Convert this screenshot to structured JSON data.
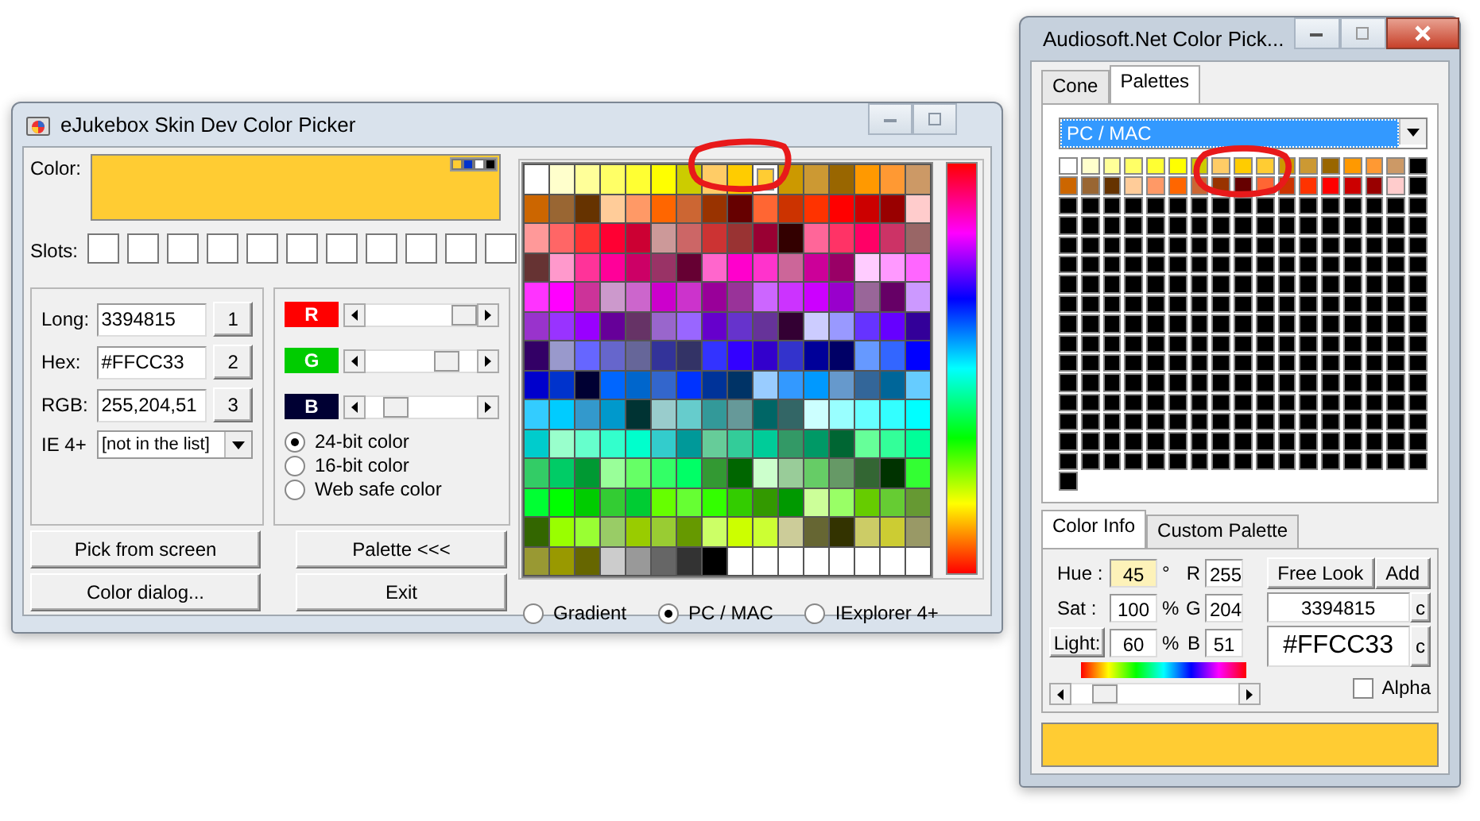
{
  "left_window": {
    "title": "eJukebox Skin Dev Color Picker",
    "color_label": "Color:",
    "color": "#ffcc33",
    "corner_marks": [
      {
        "color": "#ffcc33"
      },
      {
        "color": "#0033cc"
      },
      {
        "color": "#ffffff"
      },
      {
        "color": "#000000"
      }
    ],
    "slots_label": "Slots:",
    "slots": [
      {
        "color": "#ffffff"
      },
      {
        "color": "#ffffff"
      },
      {
        "color": "#ffffff"
      },
      {
        "color": "#ffffff"
      },
      {
        "color": "#ffffff"
      },
      {
        "color": "#ffffff"
      },
      {
        "color": "#ffffff"
      },
      {
        "color": "#ffffff"
      },
      {
        "color": "#ffffff"
      },
      {
        "color": "#ffffff"
      },
      {
        "color": "#ffffff"
      }
    ],
    "fields": [
      {
        "label": "Long:",
        "value": "3394815",
        "button": "1"
      },
      {
        "label": "Hex:",
        "value": "#FFCC33",
        "button": "2"
      },
      {
        "label": "RGB:",
        "value": "255,204,51",
        "button": "3"
      }
    ],
    "ie": {
      "label": "IE 4+",
      "value": "[not in the list]"
    },
    "channels": [
      {
        "label": "R",
        "color": "#ff0000",
        "level": 1
      },
      {
        "label": "G",
        "color": "#00cc00",
        "level": 0.8
      },
      {
        "label": "B",
        "color": "#000033",
        "level": 0.2
      }
    ],
    "depth_options": [
      {
        "label": "24-bit color",
        "selected": true
      },
      {
        "label": "16-bit color",
        "selected": false
      },
      {
        "label": "Web safe color",
        "selected": false
      }
    ],
    "buttons": [
      "Pick from screen",
      "Palette <<<",
      "Color dialog...",
      "Exit"
    ],
    "palette": [
      [
        {
          "color": "#ffffff",
          "selected": false
        },
        {
          "color": "#ffffcc",
          "selected": false
        },
        {
          "color": "#ffff99",
          "selected": false
        },
        {
          "color": "#ffff66",
          "selected": false
        },
        {
          "color": "#ffff33",
          "selected": false
        },
        {
          "color": "#ffff00",
          "selected": false
        },
        {
          "color": "#cccc00",
          "selected": false
        },
        {
          "color": "#ffcc66",
          "selected": false
        },
        {
          "color": "#ffcc00",
          "selected": false
        },
        {
          "color": "#ffcc33",
          "selected": true
        },
        {
          "color": "#cc9900",
          "selected": false
        },
        {
          "color": "#cc9933",
          "selected": false
        },
        {
          "color": "#996600",
          "selected": false
        },
        {
          "color": "#ff9900",
          "selected": false
        },
        {
          "color": "#ff9933",
          "selected": false
        },
        {
          "color": "#cc9966",
          "selected": false
        }
      ],
      [
        {
          "color": "#cc6600",
          "selected": false
        },
        {
          "color": "#996633",
          "selected": false
        },
        {
          "color": "#663300",
          "selected": false
        },
        {
          "color": "#ffcc99",
          "selected": false
        },
        {
          "color": "#ff9966",
          "selected": false
        },
        {
          "color": "#ff6600",
          "selected": false
        },
        {
          "color": "#cc6633",
          "selected": false
        },
        {
          "color": "#993300",
          "selected": false
        },
        {
          "color": "#660000",
          "selected": false
        },
        {
          "color": "#ff6633",
          "selected": false
        },
        {
          "color": "#cc3300",
          "selected": false
        },
        {
          "color": "#ff3300",
          "selected": false
        },
        {
          "color": "#ff0000",
          "selected": false
        },
        {
          "color": "#cc0000",
          "selected": false
        },
        {
          "color": "#990000",
          "selected": false
        },
        {
          "color": "#ffcccc",
          "selected": false
        }
      ],
      [
        {
          "color": "#ff9999",
          "selected": false
        },
        {
          "color": "#ff6666",
          "selected": false
        },
        {
          "color": "#ff3333",
          "selected": false
        },
        {
          "color": "#ff0033",
          "selected": false
        },
        {
          "color": "#cc0033",
          "selected": false
        },
        {
          "color": "#cc9999",
          "selected": false
        },
        {
          "color": "#cc6666",
          "selected": false
        },
        {
          "color": "#cc3333",
          "selected": false
        },
        {
          "color": "#993333",
          "selected": false
        },
        {
          "color": "#990033",
          "selected": false
        },
        {
          "color": "#330000",
          "selected": false
        },
        {
          "color": "#ff6699",
          "selected": false
        },
        {
          "color": "#ff3366",
          "selected": false
        },
        {
          "color": "#ff0066",
          "selected": false
        },
        {
          "color": "#cc3366",
          "selected": false
        },
        {
          "color": "#996666",
          "selected": false
        }
      ],
      [
        {
          "color": "#663333",
          "selected": false
        },
        {
          "color": "#ff99cc",
          "selected": false
        },
        {
          "color": "#ff3399",
          "selected": false
        },
        {
          "color": "#ff0099",
          "selected": false
        },
        {
          "color": "#cc0066",
          "selected": false
        },
        {
          "color": "#993366",
          "selected": false
        },
        {
          "color": "#660033",
          "selected": false
        },
        {
          "color": "#ff66cc",
          "selected": false
        },
        {
          "color": "#ff00cc",
          "selected": false
        },
        {
          "color": "#ff33cc",
          "selected": false
        },
        {
          "color": "#cc6699",
          "selected": false
        },
        {
          "color": "#cc0099",
          "selected": false
        },
        {
          "color": "#990066",
          "selected": false
        },
        {
          "color": "#ffccff",
          "selected": false
        },
        {
          "color": "#ff99ff",
          "selected": false
        },
        {
          "color": "#ff66ff",
          "selected": false
        }
      ],
      [
        {
          "color": "#ff33ff",
          "selected": false
        },
        {
          "color": "#ff00ff",
          "selected": false
        },
        {
          "color": "#cc3399",
          "selected": false
        },
        {
          "color": "#cc99cc",
          "selected": false
        },
        {
          "color": "#cc66cc",
          "selected": false
        },
        {
          "color": "#cc00cc",
          "selected": false
        },
        {
          "color": "#cc33cc",
          "selected": false
        },
        {
          "color": "#990099",
          "selected": false
        },
        {
          "color": "#993399",
          "selected": false
        },
        {
          "color": "#cc66ff",
          "selected": false
        },
        {
          "color": "#cc33ff",
          "selected": false
        },
        {
          "color": "#cc00ff",
          "selected": false
        },
        {
          "color": "#9900cc",
          "selected": false
        },
        {
          "color": "#996699",
          "selected": false
        },
        {
          "color": "#660066",
          "selected": false
        },
        {
          "color": "#cc99ff",
          "selected": false
        }
      ],
      [
        {
          "color": "#9933cc",
          "selected": false
        },
        {
          "color": "#9933ff",
          "selected": false
        },
        {
          "color": "#9900ff",
          "selected": false
        },
        {
          "color": "#660099",
          "selected": false
        },
        {
          "color": "#663366",
          "selected": false
        },
        {
          "color": "#9966cc",
          "selected": false
        },
        {
          "color": "#9966ff",
          "selected": false
        },
        {
          "color": "#6600cc",
          "selected": false
        },
        {
          "color": "#6633cc",
          "selected": false
        },
        {
          "color": "#663399",
          "selected": false
        },
        {
          "color": "#330033",
          "selected": false
        },
        {
          "color": "#ccccff",
          "selected": false
        },
        {
          "color": "#9999ff",
          "selected": false
        },
        {
          "color": "#6633ff",
          "selected": false
        },
        {
          "color": "#6600ff",
          "selected": false
        },
        {
          "color": "#330099",
          "selected": false
        }
      ],
      [
        {
          "color": "#330066",
          "selected": false
        },
        {
          "color": "#9999cc",
          "selected": false
        },
        {
          "color": "#6666ff",
          "selected": false
        },
        {
          "color": "#6666cc",
          "selected": false
        },
        {
          "color": "#666699",
          "selected": false
        },
        {
          "color": "#333399",
          "selected": false
        },
        {
          "color": "#333366",
          "selected": false
        },
        {
          "color": "#3333ff",
          "selected": false
        },
        {
          "color": "#3300ff",
          "selected": false
        },
        {
          "color": "#3300cc",
          "selected": false
        },
        {
          "color": "#3333cc",
          "selected": false
        },
        {
          "color": "#000099",
          "selected": false
        },
        {
          "color": "#000066",
          "selected": false
        },
        {
          "color": "#6699ff",
          "selected": false
        },
        {
          "color": "#3366ff",
          "selected": false
        },
        {
          "color": "#0000ff",
          "selected": false
        }
      ],
      [
        {
          "color": "#0000cc",
          "selected": false
        },
        {
          "color": "#0033cc",
          "selected": false
        },
        {
          "color": "#000033",
          "selected": false
        },
        {
          "color": "#0066ff",
          "selected": false
        },
        {
          "color": "#0066cc",
          "selected": false
        },
        {
          "color": "#3366cc",
          "selected": false
        },
        {
          "color": "#0033ff",
          "selected": false
        },
        {
          "color": "#003399",
          "selected": false
        },
        {
          "color": "#003366",
          "selected": false
        },
        {
          "color": "#99ccff",
          "selected": false
        },
        {
          "color": "#3399ff",
          "selected": false
        },
        {
          "color": "#0099ff",
          "selected": false
        },
        {
          "color": "#6699cc",
          "selected": false
        },
        {
          "color": "#336699",
          "selected": false
        },
        {
          "color": "#006699",
          "selected": false
        },
        {
          "color": "#66ccff",
          "selected": false
        }
      ],
      [
        {
          "color": "#33ccff",
          "selected": false
        },
        {
          "color": "#00ccff",
          "selected": false
        },
        {
          "color": "#3399cc",
          "selected": false
        },
        {
          "color": "#0099cc",
          "selected": false
        },
        {
          "color": "#003333",
          "selected": false
        },
        {
          "color": "#99cccc",
          "selected": false
        },
        {
          "color": "#66cccc",
          "selected": false
        },
        {
          "color": "#339999",
          "selected": false
        },
        {
          "color": "#669999",
          "selected": false
        },
        {
          "color": "#006666",
          "selected": false
        },
        {
          "color": "#336666",
          "selected": false
        },
        {
          "color": "#ccffff",
          "selected": false
        },
        {
          "color": "#99ffff",
          "selected": false
        },
        {
          "color": "#66ffff",
          "selected": false
        },
        {
          "color": "#33ffff",
          "selected": false
        },
        {
          "color": "#00ffff",
          "selected": false
        }
      ],
      [
        {
          "color": "#00cccc",
          "selected": false
        },
        {
          "color": "#99ffcc",
          "selected": false
        },
        {
          "color": "#66ffcc",
          "selected": false
        },
        {
          "color": "#33ffcc",
          "selected": false
        },
        {
          "color": "#00ffcc",
          "selected": false
        },
        {
          "color": "#33cccc",
          "selected": false
        },
        {
          "color": "#009999",
          "selected": false
        },
        {
          "color": "#66cc99",
          "selected": false
        },
        {
          "color": "#33cc99",
          "selected": false
        },
        {
          "color": "#00cc99",
          "selected": false
        },
        {
          "color": "#339966",
          "selected": false
        },
        {
          "color": "#009966",
          "selected": false
        },
        {
          "color": "#006633",
          "selected": false
        },
        {
          "color": "#66ff99",
          "selected": false
        },
        {
          "color": "#33ff99",
          "selected": false
        },
        {
          "color": "#00ff99",
          "selected": false
        }
      ],
      [
        {
          "color": "#33cc66",
          "selected": false
        },
        {
          "color": "#00cc66",
          "selected": false
        },
        {
          "color": "#009933",
          "selected": false
        },
        {
          "color": "#99ff99",
          "selected": false
        },
        {
          "color": "#66ff66",
          "selected": false
        },
        {
          "color": "#33ff66",
          "selected": false
        },
        {
          "color": "#00ff66",
          "selected": false
        },
        {
          "color": "#339933",
          "selected": false
        },
        {
          "color": "#006600",
          "selected": false
        },
        {
          "color": "#ccffcc",
          "selected": false
        },
        {
          "color": "#99cc99",
          "selected": false
        },
        {
          "color": "#66cc66",
          "selected": false
        },
        {
          "color": "#669966",
          "selected": false
        },
        {
          "color": "#336633",
          "selected": false
        },
        {
          "color": "#003300",
          "selected": false
        },
        {
          "color": "#33ff33",
          "selected": false
        }
      ],
      [
        {
          "color": "#00ff33",
          "selected": false
        },
        {
          "color": "#00ff00",
          "selected": false
        },
        {
          "color": "#00cc00",
          "selected": false
        },
        {
          "color": "#33cc33",
          "selected": false
        },
        {
          "color": "#00cc33",
          "selected": false
        },
        {
          "color": "#66ff00",
          "selected": false
        },
        {
          "color": "#66ff33",
          "selected": false
        },
        {
          "color": "#33ff00",
          "selected": false
        },
        {
          "color": "#33cc00",
          "selected": false
        },
        {
          "color": "#339900",
          "selected": false
        },
        {
          "color": "#009900",
          "selected": false
        },
        {
          "color": "#ccff99",
          "selected": false
        },
        {
          "color": "#99ff66",
          "selected": false
        },
        {
          "color": "#66cc00",
          "selected": false
        },
        {
          "color": "#66cc33",
          "selected": false
        },
        {
          "color": "#669933",
          "selected": false
        }
      ],
      [
        {
          "color": "#336600",
          "selected": false
        },
        {
          "color": "#99ff00",
          "selected": false
        },
        {
          "color": "#99ff33",
          "selected": false
        },
        {
          "color": "#99cc66",
          "selected": false
        },
        {
          "color": "#99cc00",
          "selected": false
        },
        {
          "color": "#99cc33",
          "selected": false
        },
        {
          "color": "#669900",
          "selected": false
        },
        {
          "color": "#ccff66",
          "selected": false
        },
        {
          "color": "#ccff00",
          "selected": false
        },
        {
          "color": "#ccff33",
          "selected": false
        },
        {
          "color": "#cccc99",
          "selected": false
        },
        {
          "color": "#666633",
          "selected": false
        },
        {
          "color": "#333300",
          "selected": false
        },
        {
          "color": "#cccc66",
          "selected": false
        },
        {
          "color": "#cccc33",
          "selected": false
        },
        {
          "color": "#999966",
          "selected": false
        }
      ],
      [
        {
          "color": "#999933",
          "selected": false
        },
        {
          "color": "#999900",
          "selected": false
        },
        {
          "color": "#666600",
          "selected": false
        },
        {
          "color": "#cccccc",
          "selected": false
        },
        {
          "color": "#999999",
          "selected": false
        },
        {
          "color": "#666666",
          "selected": false
        },
        {
          "color": "#333333",
          "selected": false
        },
        {
          "color": "#000000",
          "selected": false
        },
        {
          "color": "#ffffff",
          "selected": false
        },
        {
          "color": "#ffffff",
          "selected": false
        },
        {
          "color": "#ffffff",
          "selected": false
        },
        {
          "color": "#ffffff",
          "selected": false
        },
        {
          "color": "#ffffff",
          "selected": false
        },
        {
          "color": "#ffffff",
          "selected": false
        },
        {
          "color": "#ffffff",
          "selected": false
        },
        {
          "color": "#ffffff",
          "selected": false
        }
      ]
    ],
    "palette_options": [
      {
        "label": "Gradient",
        "selected": false
      },
      {
        "label": "PC / MAC",
        "selected": true
      },
      {
        "label": "IExplorer 4+",
        "selected": false
      }
    ]
  },
  "right_window": {
    "title": "Audiosoft.Net Color Pick...",
    "tabs": [
      {
        "label": "Cone",
        "selected": false
      },
      {
        "label": "Palettes",
        "selected": true
      }
    ],
    "palette_select": "PC / MAC",
    "grid": [
      [
        {
          "color": "#ffffff"
        },
        {
          "color": "#ffffcc"
        },
        {
          "color": "#ffff99"
        },
        {
          "color": "#ffff66"
        },
        {
          "color": "#ffff33"
        },
        {
          "color": "#ffff00"
        },
        {
          "color": "#cccc00"
        },
        {
          "color": "#ffcc66"
        },
        {
          "color": "#ffcc00"
        },
        {
          "color": "#ffcc33"
        },
        {
          "color": "#cc9900"
        },
        {
          "color": "#cc9933"
        },
        {
          "color": "#996600"
        },
        {
          "color": "#ff9900"
        },
        {
          "color": "#ff9933"
        },
        {
          "color": "#cc9966"
        },
        {
          "color": "#000000"
        }
      ],
      [
        {
          "color": "#cc6600"
        },
        {
          "color": "#996633"
        },
        {
          "color": "#663300"
        },
        {
          "color": "#ffcc99"
        },
        {
          "color": "#ff9966"
        },
        {
          "color": "#ff6600"
        },
        {
          "color": "#cc6633"
        },
        {
          "color": "#993300"
        },
        {
          "color": "#660000"
        },
        {
          "color": "#ff6633"
        },
        {
          "color": "#cc3300"
        },
        {
          "color": "#ff3300"
        },
        {
          "color": "#ff0000"
        },
        {
          "color": "#cc0000"
        },
        {
          "color": "#990000"
        },
        {
          "color": "#ffcccc"
        },
        {
          "color": "#000000"
        }
      ],
      [
        {
          "color": "#000000"
        },
        {
          "color": "#000000"
        },
        {
          "color": "#000000"
        },
        {
          "color": "#000000"
        },
        {
          "color": "#000000"
        },
        {
          "color": "#000000"
        },
        {
          "color": "#000000"
        },
        {
          "color": "#000000"
        },
        {
          "color": "#000000"
        },
        {
          "color": "#000000"
        },
        {
          "color": "#000000"
        },
        {
          "color": "#000000"
        },
        {
          "color": "#000000"
        },
        {
          "color": "#000000"
        },
        {
          "color": "#000000"
        },
        {
          "color": "#000000"
        },
        {
          "color": "#000000"
        }
      ],
      [
        {
          "color": "#000000"
        },
        {
          "color": "#000000"
        },
        {
          "color": "#000000"
        },
        {
          "color": "#000000"
        },
        {
          "color": "#000000"
        },
        {
          "color": "#000000"
        },
        {
          "color": "#000000"
        },
        {
          "color": "#000000"
        },
        {
          "color": "#000000"
        },
        {
          "color": "#000000"
        },
        {
          "color": "#000000"
        },
        {
          "color": "#000000"
        },
        {
          "color": "#000000"
        },
        {
          "color": "#000000"
        },
        {
          "color": "#000000"
        },
        {
          "color": "#000000"
        },
        {
          "color": "#000000"
        }
      ],
      [
        {
          "color": "#000000"
        },
        {
          "color": "#000000"
        },
        {
          "color": "#000000"
        },
        {
          "color": "#000000"
        },
        {
          "color": "#000000"
        },
        {
          "color": "#000000"
        },
        {
          "color": "#000000"
        },
        {
          "color": "#000000"
        },
        {
          "color": "#000000"
        },
        {
          "color": "#000000"
        },
        {
          "color": "#000000"
        },
        {
          "color": "#000000"
        },
        {
          "color": "#000000"
        },
        {
          "color": "#000000"
        },
        {
          "color": "#000000"
        },
        {
          "color": "#000000"
        },
        {
          "color": "#000000"
        }
      ],
      [
        {
          "color": "#000000"
        },
        {
          "color": "#000000"
        },
        {
          "color": "#000000"
        },
        {
          "color": "#000000"
        },
        {
          "color": "#000000"
        },
        {
          "color": "#000000"
        },
        {
          "color": "#000000"
        },
        {
          "color": "#000000"
        },
        {
          "color": "#000000"
        },
        {
          "color": "#000000"
        },
        {
          "color": "#000000"
        },
        {
          "color": "#000000"
        },
        {
          "color": "#000000"
        },
        {
          "color": "#000000"
        },
        {
          "color": "#000000"
        },
        {
          "color": "#000000"
        },
        {
          "color": "#000000"
        }
      ],
      [
        {
          "color": "#000000"
        },
        {
          "color": "#000000"
        },
        {
          "color": "#000000"
        },
        {
          "color": "#000000"
        },
        {
          "color": "#000000"
        },
        {
          "color": "#000000"
        },
        {
          "color": "#000000"
        },
        {
          "color": "#000000"
        },
        {
          "color": "#000000"
        },
        {
          "color": "#000000"
        },
        {
          "color": "#000000"
        },
        {
          "color": "#000000"
        },
        {
          "color": "#000000"
        },
        {
          "color": "#000000"
        },
        {
          "color": "#000000"
        },
        {
          "color": "#000000"
        },
        {
          "color": "#000000"
        }
      ],
      [
        {
          "color": "#000000"
        },
        {
          "color": "#000000"
        },
        {
          "color": "#000000"
        },
        {
          "color": "#000000"
        },
        {
          "color": "#000000"
        },
        {
          "color": "#000000"
        },
        {
          "color": "#000000"
        },
        {
          "color": "#000000"
        },
        {
          "color": "#000000"
        },
        {
          "color": "#000000"
        },
        {
          "color": "#000000"
        },
        {
          "color": "#000000"
        },
        {
          "color": "#000000"
        },
        {
          "color": "#000000"
        },
        {
          "color": "#000000"
        },
        {
          "color": "#000000"
        },
        {
          "color": "#000000"
        }
      ],
      [
        {
          "color": "#000000"
        },
        {
          "color": "#000000"
        },
        {
          "color": "#000000"
        },
        {
          "color": "#000000"
        },
        {
          "color": "#000000"
        },
        {
          "color": "#000000"
        },
        {
          "color": "#000000"
        },
        {
          "color": "#000000"
        },
        {
          "color": "#000000"
        },
        {
          "color": "#000000"
        },
        {
          "color": "#000000"
        },
        {
          "color": "#000000"
        },
        {
          "color": "#000000"
        },
        {
          "color": "#000000"
        },
        {
          "color": "#000000"
        },
        {
          "color": "#000000"
        },
        {
          "color": "#000000"
        }
      ],
      [
        {
          "color": "#000000"
        },
        {
          "color": "#000000"
        },
        {
          "color": "#000000"
        },
        {
          "color": "#000000"
        },
        {
          "color": "#000000"
        },
        {
          "color": "#000000"
        },
        {
          "color": "#000000"
        },
        {
          "color": "#000000"
        },
        {
          "color": "#000000"
        },
        {
          "color": "#000000"
        },
        {
          "color": "#000000"
        },
        {
          "color": "#000000"
        },
        {
          "color": "#000000"
        },
        {
          "color": "#000000"
        },
        {
          "color": "#000000"
        },
        {
          "color": "#000000"
        },
        {
          "color": "#000000"
        }
      ],
      [
        {
          "color": "#000000"
        },
        {
          "color": "#000000"
        },
        {
          "color": "#000000"
        },
        {
          "color": "#000000"
        },
        {
          "color": "#000000"
        },
        {
          "color": "#000000"
        },
        {
          "color": "#000000"
        },
        {
          "color": "#000000"
        },
        {
          "color": "#000000"
        },
        {
          "color": "#000000"
        },
        {
          "color": "#000000"
        },
        {
          "color": "#000000"
        },
        {
          "color": "#000000"
        },
        {
          "color": "#000000"
        },
        {
          "color": "#000000"
        },
        {
          "color": "#000000"
        },
        {
          "color": "#000000"
        }
      ],
      [
        {
          "color": "#000000"
        },
        {
          "color": "#000000"
        },
        {
          "color": "#000000"
        },
        {
          "color": "#000000"
        },
        {
          "color": "#000000"
        },
        {
          "color": "#000000"
        },
        {
          "color": "#000000"
        },
        {
          "color": "#000000"
        },
        {
          "color": "#000000"
        },
        {
          "color": "#000000"
        },
        {
          "color": "#000000"
        },
        {
          "color": "#000000"
        },
        {
          "color": "#000000"
        },
        {
          "color": "#000000"
        },
        {
          "color": "#000000"
        },
        {
          "color": "#000000"
        },
        {
          "color": "#000000"
        }
      ],
      [
        {
          "color": "#000000"
        },
        {
          "color": "#000000"
        },
        {
          "color": "#000000"
        },
        {
          "color": "#000000"
        },
        {
          "color": "#000000"
        },
        {
          "color": "#000000"
        },
        {
          "color": "#000000"
        },
        {
          "color": "#000000"
        },
        {
          "color": "#000000"
        },
        {
          "color": "#000000"
        },
        {
          "color": "#000000"
        },
        {
          "color": "#000000"
        },
        {
          "color": "#000000"
        },
        {
          "color": "#000000"
        },
        {
          "color": "#000000"
        },
        {
          "color": "#000000"
        },
        {
          "color": "#000000"
        }
      ],
      [
        {
          "color": "#000000"
        },
        {
          "color": "#000000"
        },
        {
          "color": "#000000"
        },
        {
          "color": "#000000"
        },
        {
          "color": "#000000"
        },
        {
          "color": "#000000"
        },
        {
          "color": "#000000"
        },
        {
          "color": "#000000"
        },
        {
          "color": "#000000"
        },
        {
          "color": "#000000"
        },
        {
          "color": "#000000"
        },
        {
          "color": "#000000"
        },
        {
          "color": "#000000"
        },
        {
          "color": "#000000"
        },
        {
          "color": "#000000"
        },
        {
          "color": "#000000"
        },
        {
          "color": "#000000"
        }
      ],
      [
        {
          "color": "#000000"
        },
        {
          "color": "#000000"
        },
        {
          "color": "#000000"
        },
        {
          "color": "#000000"
        },
        {
          "color": "#000000"
        },
        {
          "color": "#000000"
        },
        {
          "color": "#000000"
        },
        {
          "color": "#000000"
        },
        {
          "color": "#000000"
        },
        {
          "color": "#000000"
        },
        {
          "color": "#000000"
        },
        {
          "color": "#000000"
        },
        {
          "color": "#000000"
        },
        {
          "color": "#000000"
        },
        {
          "color": "#000000"
        },
        {
          "color": "#000000"
        },
        {
          "color": "#000000"
        }
      ],
      [
        {
          "color": "#000000"
        },
        {
          "color": "#000000"
        },
        {
          "color": "#000000"
        },
        {
          "color": "#000000"
        },
        {
          "color": "#000000"
        },
        {
          "color": "#000000"
        },
        {
          "color": "#000000"
        },
        {
          "color": "#000000"
        },
        {
          "color": "#000000"
        },
        {
          "color": "#000000"
        },
        {
          "color": "#000000"
        },
        {
          "color": "#000000"
        },
        {
          "color": "#000000"
        },
        {
          "color": "#000000"
        },
        {
          "color": "#000000"
        },
        {
          "color": "#000000"
        },
        {
          "color": "#000000"
        }
      ],
      [
        {
          "color": "#000000"
        }
      ]
    ],
    "info_tabs": [
      {
        "label": "Color Info",
        "selected": true
      },
      {
        "label": "Custom Palette",
        "selected": false
      }
    ],
    "hsl": [
      {
        "label": "Hue :",
        "kind": "label",
        "value": "45",
        "focused": true,
        "unit": "°"
      },
      {
        "label": "Sat :",
        "kind": "label",
        "value": "100",
        "focused": false,
        "unit": "%"
      },
      {
        "label": "Light:",
        "kind": "button",
        "value": "60",
        "focused": false,
        "unit": "%"
      }
    ],
    "rgb": [
      {
        "label": "R",
        "value": "255"
      },
      {
        "label": "G",
        "value": "204"
      },
      {
        "label": "B",
        "value": "51"
      }
    ],
    "buttons": [
      "Free Look",
      "Add"
    ],
    "long": {
      "value": "3394815",
      "button": "c"
    },
    "hex": {
      "value": "#FFCC33",
      "button": "c"
    },
    "hue_scroll": {
      "level": 0.15
    },
    "alpha": {
      "label": "Alpha",
      "checked": false
    },
    "preview": {
      "color": "#ffcc33"
    }
  }
}
